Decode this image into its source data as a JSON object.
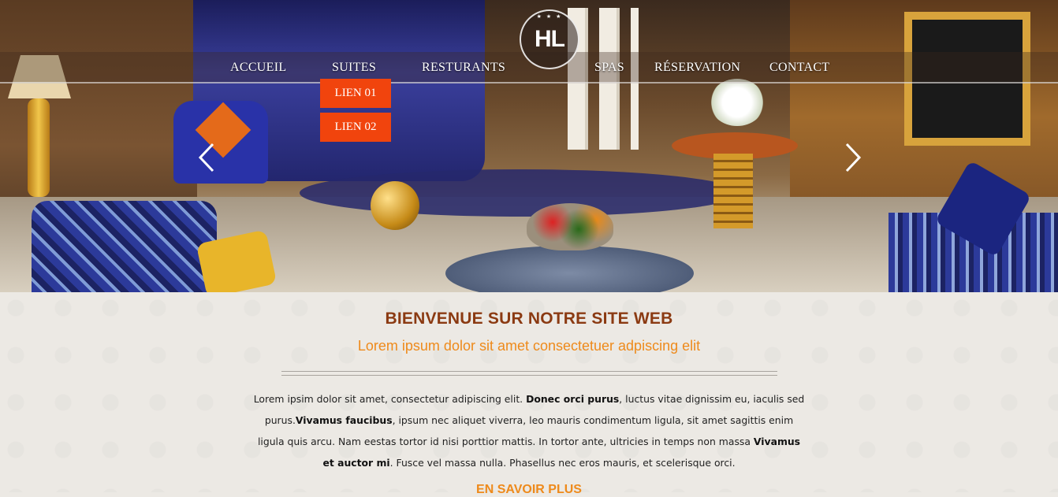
{
  "logo": {
    "text": "HL",
    "stars": "★ ★ ★"
  },
  "nav": {
    "items": [
      {
        "label": "ACCUEIL"
      },
      {
        "label": "SUITES"
      },
      {
        "label": "RESTURANTS"
      },
      {
        "label": "SPAS"
      },
      {
        "label": "RÉSERVATION"
      },
      {
        "label": "CONTACT"
      }
    ],
    "dropdown": [
      {
        "label": "LIEN 01"
      },
      {
        "label": "LIEN 02"
      }
    ]
  },
  "colors": {
    "dropdown_bg": "#f1440d",
    "title": "#8b3a12",
    "accent": "#ee8a1b"
  },
  "content": {
    "title": "BIENVENUE SUR NOTRE SITE WEB",
    "subtitle": "Lorem ipsum dolor sit amet consectetuer adpiscing elit",
    "paragraph": {
      "p1": "Lorem ipsim dolor sit amet, consectetur adipiscing elit. ",
      "b1": "Donec orci purus",
      "p2": ", luctus vitae dignissim eu, iaculis sed purus.",
      "b2": "Vivamus faucibus",
      "p3": ", ipsum nec aliquet viverra, leo mauris condimentum ligula, sit amet sagittis enim ligula quis arcu. Nam eestas tortor id nisi porttior mattis. In tortor ante, ultricies in temps non massa ",
      "b3": "Vivamus et auctor mi",
      "p4": ". Fusce vel massa nulla. Phasellus nec eros mauris, et scelerisque orci."
    },
    "more_link": "EN SAVOIR PLUS"
  }
}
